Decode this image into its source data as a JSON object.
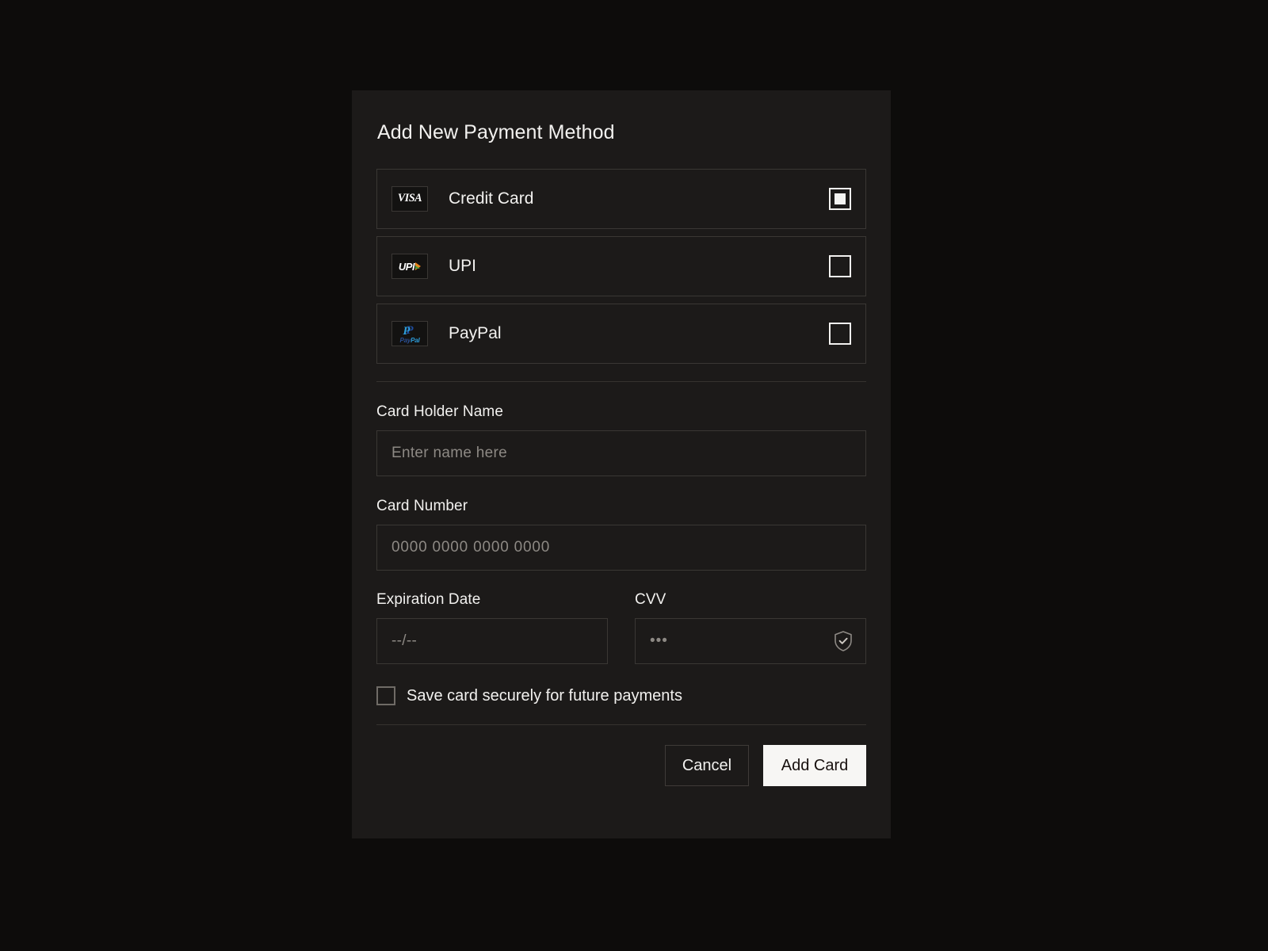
{
  "dialog": {
    "title": "Add New Payment Method"
  },
  "payment_methods": [
    {
      "label": "Credit Card",
      "logo": "visa-logo",
      "logo_text": "VISA",
      "selected": true
    },
    {
      "label": "UPI",
      "logo": "upi-logo",
      "logo_text": "UPI",
      "selected": false
    },
    {
      "label": "PayPal",
      "logo": "paypal-logo",
      "logo_text": "PayPal",
      "selected": false
    }
  ],
  "form": {
    "card_holder": {
      "label": "Card Holder Name",
      "value": "",
      "placeholder": "Enter name here"
    },
    "card_number": {
      "label": "Card Number",
      "value": "",
      "placeholder": "0000 0000 0000 0000"
    },
    "expiration": {
      "label": "Expiration Date",
      "value": "",
      "placeholder": "--/--"
    },
    "cvv": {
      "label": "CVV",
      "value": "",
      "placeholder": "•••",
      "icon": "shield-check-icon"
    },
    "save_card": {
      "label": "Save card securely for future payments",
      "checked": false
    }
  },
  "actions": {
    "cancel_label": "Cancel",
    "submit_label": "Add Card"
  },
  "colors": {
    "page_background": "#0d0c0b",
    "dialog_background": "#1c1a19",
    "border": "#3a3734",
    "text_primary": "#f2f1ef",
    "text_placeholder": "#8d8984",
    "primary_button_bg": "#f7f6f4",
    "primary_button_text": "#17100e"
  }
}
